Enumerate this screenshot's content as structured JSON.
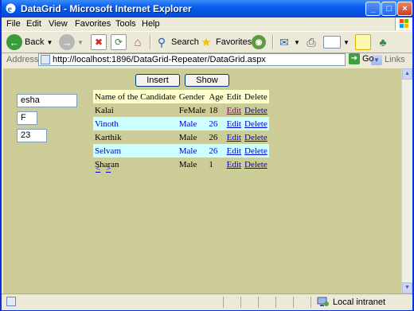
{
  "window": {
    "title": "DataGrid - Microsoft Internet Explorer",
    "controls": {
      "minimize": "_",
      "maximize": "□",
      "close": "×"
    }
  },
  "menubar": [
    "File",
    "Edit",
    "View",
    "Favorites",
    "Tools",
    "Help"
  ],
  "toolbar": {
    "back": "Back",
    "search": "Search",
    "favorites": "Favorites"
  },
  "address": {
    "label": "Address",
    "url": "http://localhost:1896/DataGrid-Repeater/DataGrid.aspx",
    "go": "Go",
    "links": "Links"
  },
  "page": {
    "insert_label": "Insert",
    "show_label": "Show",
    "name_value": "esha",
    "gender_value": "F",
    "age_value": "23",
    "grid": {
      "headers": [
        "Name of the Candidate",
        "Gender",
        "Age",
        "Edit",
        "Delete"
      ],
      "rows": [
        {
          "name": "Kalai",
          "gender": "FeMale",
          "age": "18",
          "edit": "Edit",
          "delete": "Delete"
        },
        {
          "name": "Vinoth",
          "gender": "Male",
          "age": "26",
          "edit": "Edit",
          "delete": "Delete"
        },
        {
          "name": "Karthik",
          "gender": "Male",
          "age": "26",
          "edit": "Edit",
          "delete": "Delete"
        },
        {
          "name": "Selvam",
          "gender": "Male",
          "age": "26",
          "edit": "Edit",
          "delete": "Delete"
        },
        {
          "name": "Sharan",
          "gender": "Male",
          "age": "1",
          "edit": "Edit",
          "delete": "Delete"
        }
      ],
      "pager": {
        "prev": "<",
        "next": ">"
      }
    }
  },
  "statusbar": {
    "zone": "Local intranet"
  },
  "colors": {
    "page_background": "#cccc99",
    "header_row": "#ffffcc",
    "alternate_row": "#ccffff",
    "link": "#0000cc",
    "visited_link": "#800080"
  }
}
